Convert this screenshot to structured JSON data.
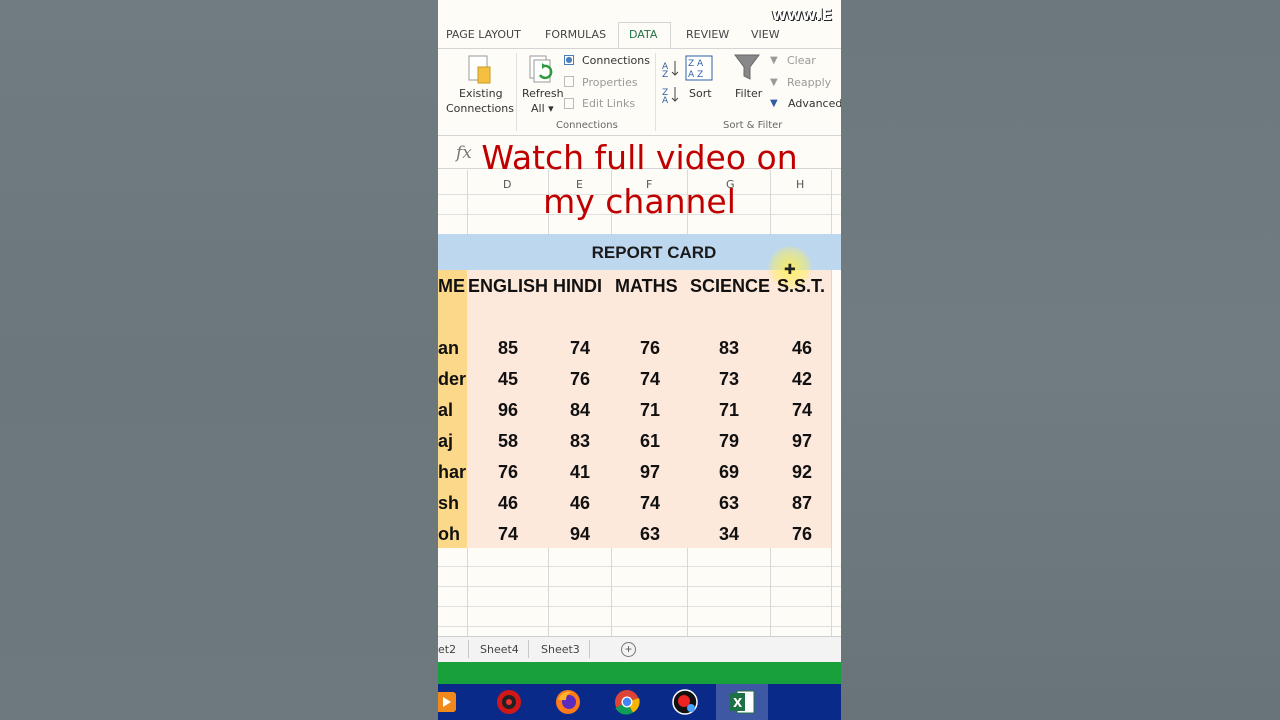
{
  "watermark": "www.E",
  "ribbon_tabs": [
    {
      "label": "PAGE LAYOUT"
    },
    {
      "label": "FORMULAS"
    },
    {
      "label": "DATA"
    },
    {
      "label": "REVIEW"
    },
    {
      "label": "VIEW"
    }
  ],
  "ribbon": {
    "existing_connections": [
      "Existing",
      "Connections"
    ],
    "refresh_all": [
      "Refresh",
      "All ▾"
    ],
    "connections": "Connections",
    "properties": "Properties",
    "edit_links": "Edit Links",
    "group_connections": "Connections",
    "sort": "Sort",
    "filter": "Filter",
    "clear": "Clear",
    "reapply": "Reapply",
    "advanced": "Advanced",
    "group_sort_filter": "Sort & Filter"
  },
  "formula_bar": {
    "fx": "fx"
  },
  "overlay": {
    "line1": "Watch full video on",
    "line2": "my channel"
  },
  "columns": [
    "D",
    "E",
    "F",
    "G",
    "H"
  ],
  "report": {
    "title": "REPORT CARD",
    "name_header": "ME",
    "subjects": [
      "ENGLISH",
      "HINDI",
      "MATHS",
      "SCIENCE",
      "S.S.T."
    ],
    "rows": [
      {
        "name": "an",
        "marks": [
          "85",
          "74",
          "76",
          "83",
          "46"
        ]
      },
      {
        "name": "der",
        "marks": [
          "45",
          "76",
          "74",
          "73",
          "42"
        ]
      },
      {
        "name": "al",
        "marks": [
          "96",
          "84",
          "71",
          "71",
          "74"
        ]
      },
      {
        "name": "aj",
        "marks": [
          "58",
          "83",
          "61",
          "79",
          "97"
        ]
      },
      {
        "name": "har",
        "marks": [
          "76",
          "41",
          "97",
          "69",
          "92"
        ]
      },
      {
        "name": "sh",
        "marks": [
          "46",
          "46",
          "74",
          "63",
          "87"
        ]
      },
      {
        "name": "oh",
        "marks": [
          "74",
          "94",
          "63",
          "34",
          "76"
        ]
      }
    ]
  },
  "sheets": [
    {
      "label": "et2"
    },
    {
      "label": "Sheet4"
    },
    {
      "label": "Sheet3"
    }
  ],
  "add_sheet": "+",
  "taskbar_icons": [
    "media-player-icon",
    "recorder-icon",
    "firefox-icon",
    "chrome-icon",
    "screen-recorder-icon",
    "excel-icon"
  ],
  "colors": {
    "title_fill": "#bdd7ee",
    "data_fill": "#fde8dc",
    "name_fill": "#fcd98a",
    "overlay_text": "#c00000",
    "status_green": "#17a03c",
    "taskbar": "#0a2a8a"
  }
}
